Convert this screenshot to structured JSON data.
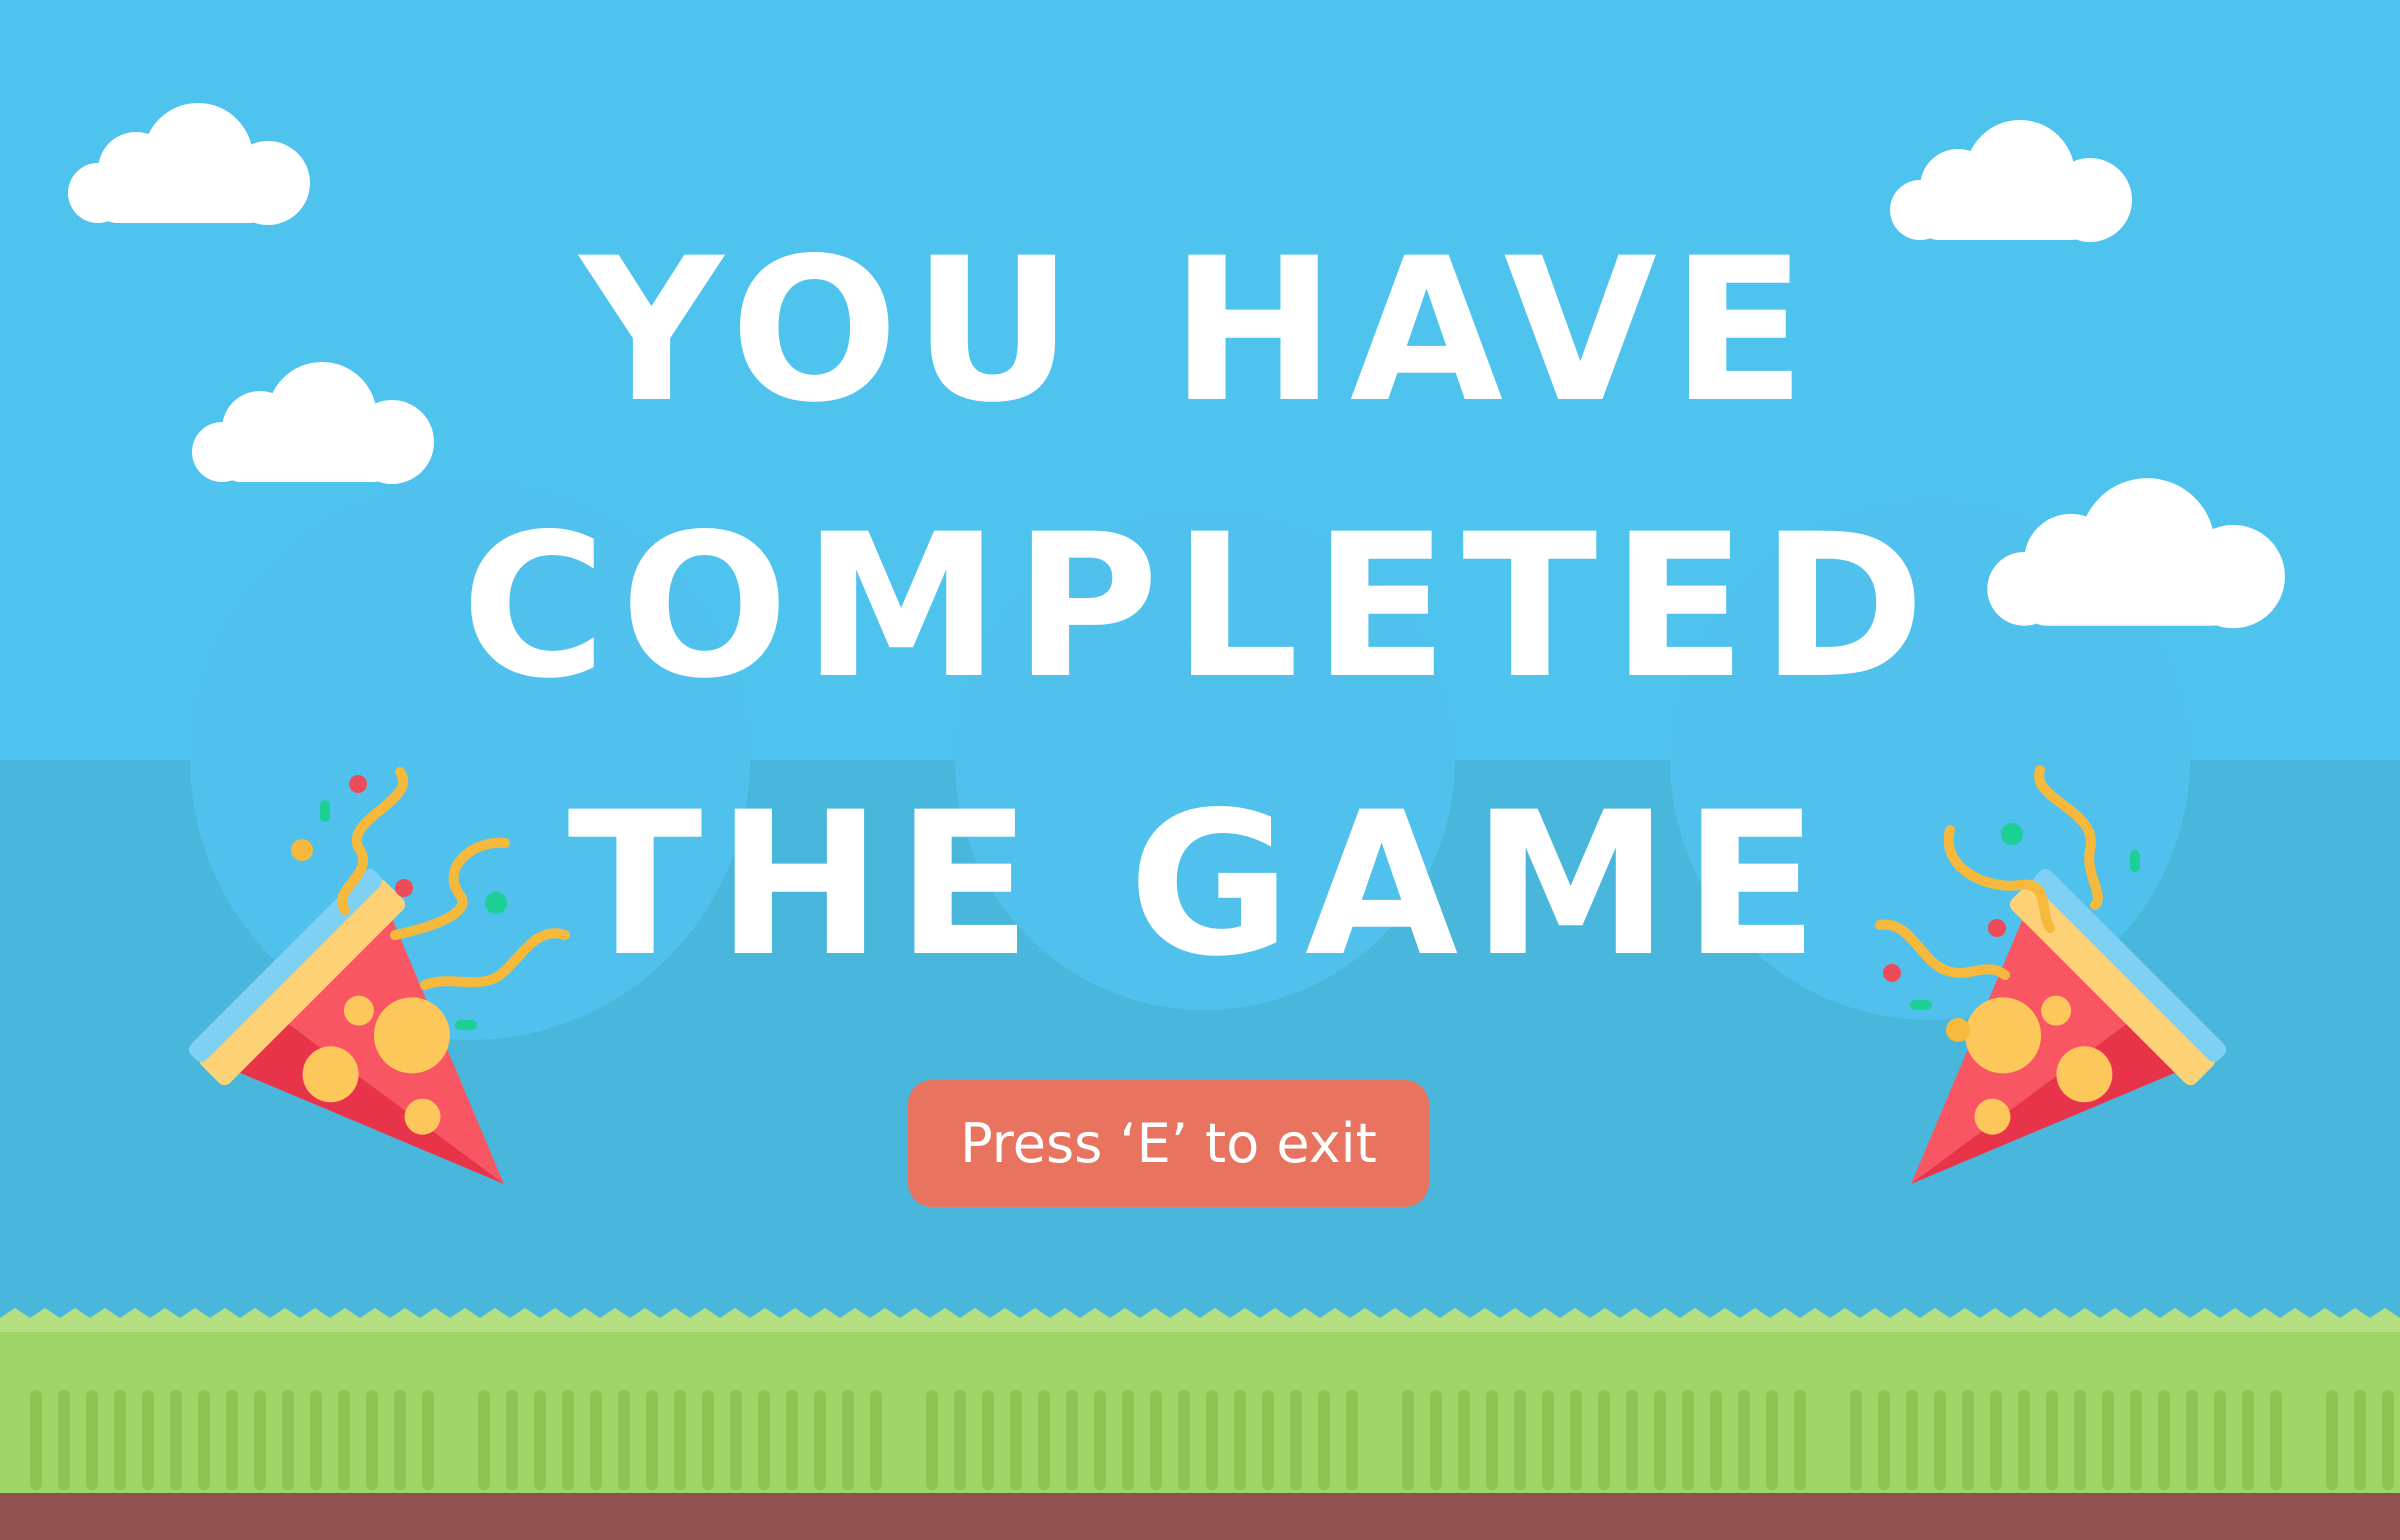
{
  "title": {
    "line1": "YOU HAVE",
    "line2": "COMPLETED",
    "line3": "THE GAME"
  },
  "exit_button": {
    "label": "Press ‘E’ to exit"
  },
  "colors": {
    "sky": "#4ec3ee",
    "sky_lower": "#49b6dc",
    "hills": "#4fc1ec",
    "grass_top": "#b5e081",
    "grass": "#a0d568",
    "grass_stripe": "#8cc552",
    "dirt": "#8f5050",
    "button": "#e8735f",
    "title_text": "#ffffff",
    "confetti_gold": "#f6b93b",
    "popper_red": "#f95664"
  },
  "icons": [
    "cloud-icon",
    "party-popper-icon",
    "confetti-icon"
  ]
}
